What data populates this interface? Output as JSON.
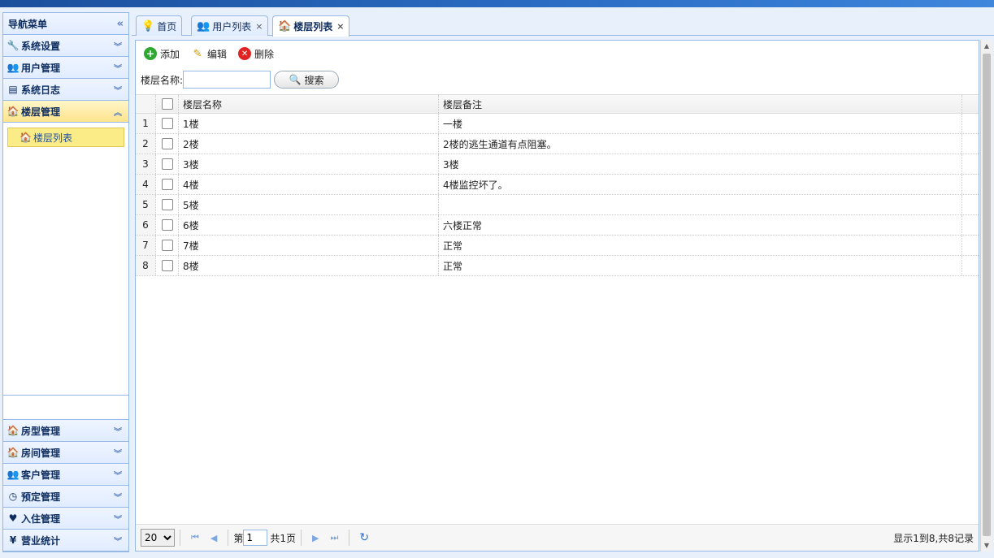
{
  "nav": {
    "title": "导航菜单",
    "collapse": "«",
    "sections_top": [
      {
        "label": "系统设置",
        "icon": "🔧"
      },
      {
        "label": "用户管理",
        "icon": "👥"
      },
      {
        "label": "系统日志",
        "icon": "▤"
      },
      {
        "label": "楼层管理",
        "icon": "🏠"
      }
    ],
    "active_sub": {
      "label": "楼层列表",
      "icon": "🏠"
    },
    "sections_bottom": [
      {
        "label": "房型管理",
        "icon": "🏠"
      },
      {
        "label": "房间管理",
        "icon": "🏠"
      },
      {
        "label": "客户管理",
        "icon": "👥"
      },
      {
        "label": "预定管理",
        "icon": "◷"
      },
      {
        "label": "入住管理",
        "icon": "♥"
      },
      {
        "label": "营业统计",
        "icon": "¥"
      }
    ]
  },
  "tabs": [
    {
      "label": "首页",
      "icon": "💡",
      "closable": false
    },
    {
      "label": "用户列表",
      "icon": "👥",
      "closable": true
    },
    {
      "label": "楼层列表",
      "icon": "🏠",
      "closable": true
    }
  ],
  "toolbar": {
    "add": "添加",
    "edit": "编辑",
    "delete": "删除"
  },
  "search": {
    "label": "楼层名称:",
    "placeholder": "",
    "value": "",
    "button": "搜索"
  },
  "grid": {
    "columns": [
      "楼层名称",
      "楼层备注"
    ],
    "rows": [
      {
        "num": "1",
        "name": "1楼",
        "note": "一楼"
      },
      {
        "num": "2",
        "name": "2楼",
        "note": "2楼的逃生通道有点阻塞。"
      },
      {
        "num": "3",
        "name": "3楼",
        "note": "3楼"
      },
      {
        "num": "4",
        "name": "4楼",
        "note": "4楼监控坏了。"
      },
      {
        "num": "5",
        "name": "5楼",
        "note": ""
      },
      {
        "num": "6",
        "name": "6楼",
        "note": "六楼正常"
      },
      {
        "num": "7",
        "name": "7楼",
        "note": "正常"
      },
      {
        "num": "8",
        "name": "8楼",
        "note": "正常"
      }
    ]
  },
  "pager": {
    "page_size": "20",
    "page_prefix": "第",
    "page_value": "1",
    "page_total": "共1页",
    "info": "显示1到8,共8记录"
  }
}
